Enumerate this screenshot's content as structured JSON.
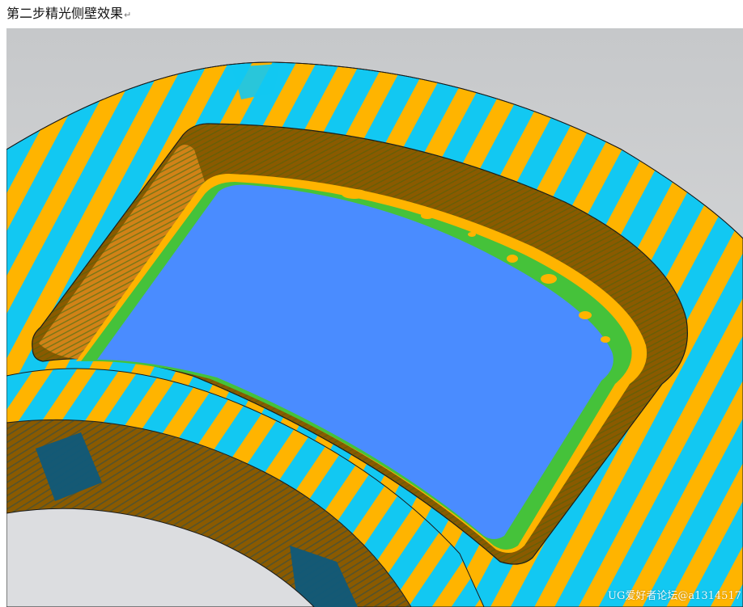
{
  "caption": {
    "text": "第二步精光侧壁效果",
    "return_mark": "↵"
  },
  "watermark": {
    "text": "UG爱好者论坛@a1314517"
  },
  "colors": {
    "background": "#cfd1d3",
    "stripe_cyan": "#12c8f2",
    "stripe_orange": "#ffb400",
    "wall_brown": "#8a5a00",
    "floor_blue": "#4a8cff",
    "floor_green": "#45c23a",
    "dark_patch": "#0f5a7a"
  }
}
